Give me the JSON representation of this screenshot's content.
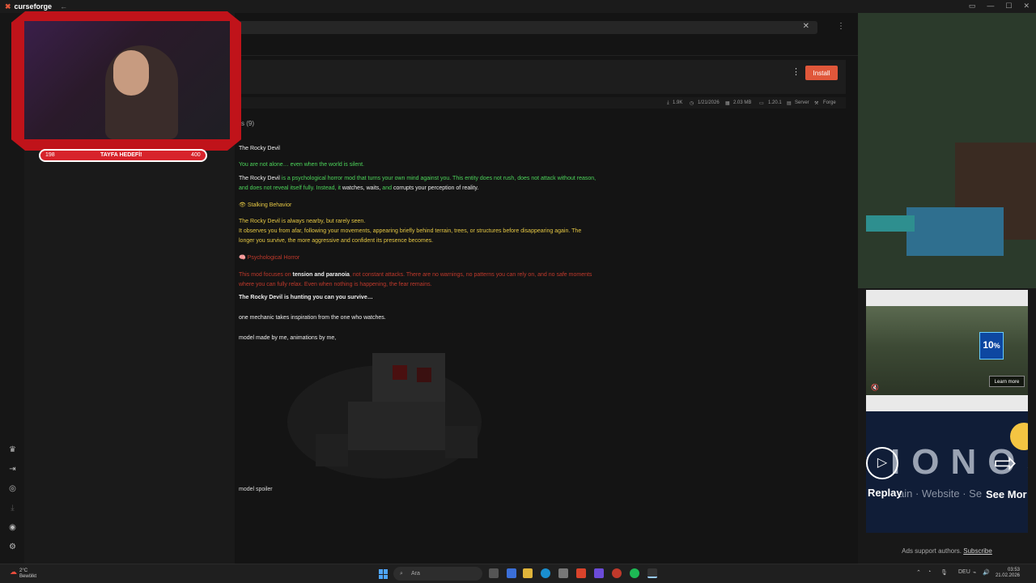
{
  "app": {
    "name": "curseforge",
    "back_glyph": "←",
    "window_controls": [
      "▭",
      "—",
      "☐",
      "✕"
    ]
  },
  "search": {
    "clear_glyph": "✕"
  },
  "top_more_glyph": "⋮",
  "mod_header": {
    "more_glyph": "⋮",
    "install_label": "Install"
  },
  "stats": {
    "downloads": "1.9K",
    "date": "1/21/2026",
    "size": "2.03 MB",
    "version": "1.20.1",
    "env": "Server",
    "loader": "Forge"
  },
  "tab_fragment": "s (9)",
  "description": {
    "title": "The Rocky Devil",
    "line1": "You are not alone… even when the world is silent.",
    "p2_a": "The Rocky Devil",
    "p2_b": " is a psychological horror mod that turns your own mind against you. This entity does not rush, does not attack without reason,",
    "p2_c": "and does not reveal itself fully. Instead, it ",
    "p2_d": "watches, waits,",
    "p2_e": " and ",
    "p2_f": "corrupts your perception of reality.",
    "section1_icon": "👁",
    "section1": "Stalking Behavior",
    "s1_l1": "The Rocky Devil is always nearby, but rarely seen.",
    "s1_l2": "It observes you from afar, following your movements, appearing briefly behind terrain, trees, or structures before disappearing again. The",
    "s1_l3": "longer you survive, the more aggressive and confident its presence becomes.",
    "section2_icon": "🧠",
    "section2": "Psychological Horror",
    "s2_a": "This mod focuses on ",
    "s2_b": "tension and paranoia",
    "s2_c": ", not constant attacks. There are no warnings, no patterns you can rely on, and no safe moments",
    "s2_l2": "where you can fully relax. Even when nothing is happening, the fear remains.",
    "hunting": "The Rocky Devil is hunting you can you survive…",
    "mechanic": "one mechanic takes inspiration from the one who watches.",
    "credit": "model made by me, animations by me,",
    "spoiler": "model spoiler"
  },
  "ads": {
    "ad1_badge": "10",
    "ad1_badge_symbol": "%",
    "ad1_learn": "Learn more",
    "ad2_brand": "IONOS",
    "ad2_sub": "ain · Website · Se",
    "ad2_replay": "Replay",
    "ad2_seemore": "See Mor",
    "support_text": "Ads support authors.",
    "subscribe": "Subscribe"
  },
  "stream_overlay": {
    "hp_left": "198",
    "hp_label": "TAYFA HEDEFİ!",
    "hp_right": "400"
  },
  "taskbar": {
    "temp": "2°C",
    "weather": "Bewölkt",
    "search_placeholder": "Ara",
    "lang": "DEU",
    "time": "03:53",
    "date": "21.02.2026"
  },
  "colors": {
    "accent": "#e0573a",
    "green_text": "#4cd45a",
    "yellow_text": "#e6c844",
    "red_text": "#c0392b"
  }
}
